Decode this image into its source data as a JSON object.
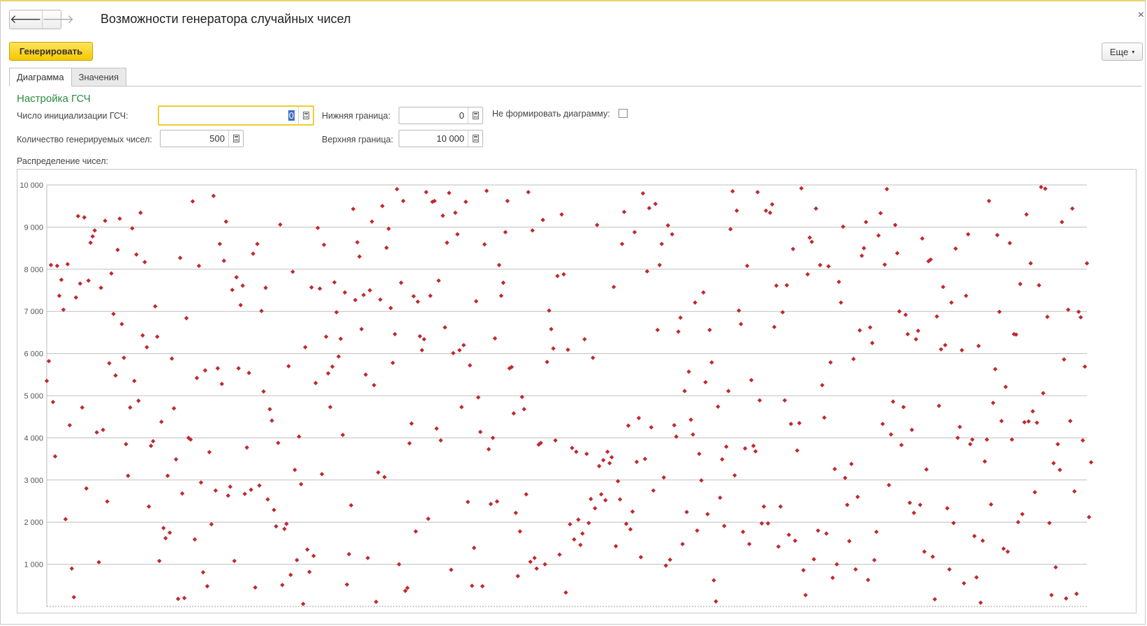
{
  "window": {
    "title": "Возможности генератора случайных чисел",
    "close_glyph": "×"
  },
  "toolbar": {
    "back_icon": "arrow-left-icon",
    "forward_icon": "arrow-right-icon",
    "back_glyph": "🡐",
    "forward_glyph": "🡒",
    "generate_label": "Генерировать",
    "more_label": "Еще",
    "more_caret": "▾"
  },
  "tabs": [
    {
      "label": "Диаграмма",
      "active": true
    },
    {
      "label": "Значения",
      "active": false
    }
  ],
  "settings": {
    "section_title": "Настройка ГСЧ",
    "seed_label": "Число инициализации ГСЧ:",
    "seed_value": "0",
    "count_label": "Количество генерируемых чисел:",
    "count_value": "500",
    "lower_label": "Нижняя граница:",
    "lower_value": "0",
    "upper_label": "Верхняя граница:",
    "upper_value": "10 000",
    "no_chart_label": "Не формировать диаграмму:",
    "no_chart_checked": false
  },
  "distribution_label": "Распределение чисел:",
  "colors": {
    "accent_yellow": "#f5c800",
    "section_green": "#2b8a3e",
    "point_red": "#c0282e",
    "grid": "#bfbfbf"
  },
  "chart_data": {
    "type": "scatter",
    "title": "",
    "xlabel": "",
    "ylabel": "",
    "ylim": [
      0,
      10000
    ],
    "xlim": [
      1,
      500
    ],
    "yticks": [
      1000,
      2000,
      3000,
      4000,
      5000,
      6000,
      7000,
      8000,
      9000,
      10000
    ],
    "ytick_labels": [
      "1 000",
      "2 000",
      "3 000",
      "4 000",
      "5 000",
      "6 000",
      "7 000",
      "8 000",
      "9 000",
      "10 000"
    ],
    "grid": true,
    "legend": "none",
    "marker": "diamond",
    "color": "#c0282e",
    "points_count": 500,
    "y": [
      5350,
      5820,
      8100,
      4850,
      3560,
      8080,
      7370,
      7750,
      7040,
      2070,
      8120,
      4300,
      900,
      220,
      7330,
      9260,
      7660,
      4720,
      9230,
      2800,
      7730,
      8630,
      8780,
      8920,
      4130,
      1050,
      7560,
      4190,
      9150,
      2490,
      5770,
      7900,
      6940,
      5480,
      8460,
      9200,
      6700,
      5900,
      3850,
      3100,
      4720,
      8970,
      5350,
      8350,
      4880,
      9340,
      6430,
      8170,
      6150,
      2370,
      3810,
      3920,
      7120,
      6400,
      1080,
      4380,
      1860,
      1620,
      3100,
      1750,
      5880,
      4700,
      3490,
      180,
      8270,
      2680,
      200,
      6840,
      4000,
      3960,
      9610,
      1590,
      5420,
      8080,
      2940,
      810,
      5600,
      480,
      3660,
      1950,
      9740,
      2750,
      5650,
      8600,
      5280,
      8200,
      9130,
      2630,
      2840,
      7510,
      1080,
      7810,
      5650,
      7150,
      7610,
      2670,
      3770,
      5540,
      2770,
      8370,
      450,
      8600,
      2870,
      7010,
      5100,
      7560,
      2540,
      4680,
      4410,
      2290,
      1900,
      3880,
      9060,
      510,
      1840,
      1960,
      5700,
      750,
      7940,
      3240,
      1100,
      4030,
      2900,
      60,
      6150,
      1350,
      820,
      7570,
      1200,
      5300,
      8980,
      7540,
      3140,
      8580,
      6400,
      5530,
      4730,
      5690,
      7690,
      6980,
      5930,
      6350,
      4070,
      7450,
      520,
      1240,
      2400,
      9430,
      7270,
      8640,
      8300,
      6580,
      7390,
      5500,
      1150,
      7500,
      9130,
      5250,
      110,
      3180,
      7280,
      9500,
      3070,
      8510,
      8960,
      7080,
      5780,
      6460,
      9900,
      1000,
      7680,
      9620,
      370,
      440,
      3870,
      4340,
      7360,
      1780,
      7230,
      6410,
      6080,
      6340,
      9830,
      2080,
      7370,
      9600,
      9620,
      4220,
      7730,
      3940,
      9270,
      6620,
      8630,
      9810,
      870,
      6010,
      9340,
      8830,
      6080,
      4730,
      6200,
      9600,
      2480,
      5720,
      490,
      1390,
      7240,
      4960,
      4140,
      480,
      8590,
      9860,
      3730,
      2430,
      4000,
      6360,
      2490,
      8100,
      7370,
      7680,
      8880,
      9620,
      5650,
      5680,
      4580,
      2220,
      720,
      1780,
      4970,
      4680,
      2660,
      9830,
      1060,
      8920,
      1150,
      900,
      3840,
      3880,
      9170,
      1000,
      5800,
      7020,
      6580,
      6120,
      3940,
      7840,
      1230,
      9300,
      7880,
      330,
      6090,
      1950,
      3760,
      1590,
      3670,
      2060,
      1460,
      1730,
      6340,
      3620,
      1980,
      2550,
      5900,
      2330,
      9050,
      3330,
      2660,
      3470,
      2520,
      3670,
      3400,
      3540,
      7580,
      1430,
      2970,
      2540,
      8600,
      9360,
      1960,
      4290,
      1830,
      2250,
      8880,
      3430,
      4470,
      1170,
      9800,
      3500,
      7950,
      9450,
      4250,
      2750,
      9550,
      6560,
      8100,
      8600,
      3060,
      970,
      9040,
      1110,
      8830,
      4300,
      4030,
      6520,
      6850,
      1480,
      5110,
      2240,
      5570,
      4430,
      4080,
      7210,
      1800,
      3620,
      2990,
      7450,
      5320,
      2190,
      6560,
      5790,
      620,
      120,
      4740,
      2580,
      3490,
      1910,
      3790,
      5110,
      8950,
      9850,
      3110,
      9390,
      7020,
      6700,
      1770,
      3750,
      8080,
      1480,
      5370,
      3810,
      3680,
      9830,
      4890,
      1970,
      2370,
      9390,
      1970,
      9340,
      9540,
      6630,
      7610,
      1420,
      2370,
      6980,
      4890,
      7620,
      1700,
      4330,
      8480,
      1560,
      3700,
      4350,
      9920,
      860,
      270,
      7880,
      8750,
      8650,
      1120,
      9440,
      1800,
      8100,
      5250,
      4480,
      1730,
      8070,
      5790,
      680,
      3260,
      1000,
      7700,
      7210,
      9010,
      3050,
      2410,
      1550,
      3380,
      5870,
      880,
      2600,
      6550,
      8320,
      8500,
      9120,
      630,
      6620,
      6250,
      1100,
      1770,
      8800,
      9330,
      4330,
      8110,
      9900,
      2880,
      4080,
      4860,
      9050,
      8380,
      7000,
      3830,
      4730,
      6920,
      6460,
      2460,
      4190,
      2220,
      6340,
      6540,
      2410,
      8730,
      1300,
      3250,
      8190,
      8230,
      1180,
      170,
      6880,
      4760,
      6100,
      7580,
      6200,
      2330,
      880,
      7210,
      1980,
      8490,
      4000,
      4260,
      6080,
      550,
      7370,
      8830,
      3850,
      3960,
      1670,
      690,
      6180,
      90,
      1560,
      3440,
      3960,
      9620,
      2420,
      4830,
      5630,
      8810,
      6990,
      4400,
      1370,
      5210,
      1300,
      8620,
      3960,
      6460,
      6450,
      2000,
      7650,
      2190,
      4370,
      9300,
      4390,
      8140,
      4630,
      2710,
      4360,
      7620,
      9950,
      5060,
      9910,
      6870,
      1980,
      270,
      3400,
      930,
      3850,
      3240,
      9120,
      5860,
      190,
      7040,
      4400,
      9440,
      2730,
      300,
      6990,
      6860,
      3940,
      5690,
      8140,
      2120,
      3420
    ]
  }
}
